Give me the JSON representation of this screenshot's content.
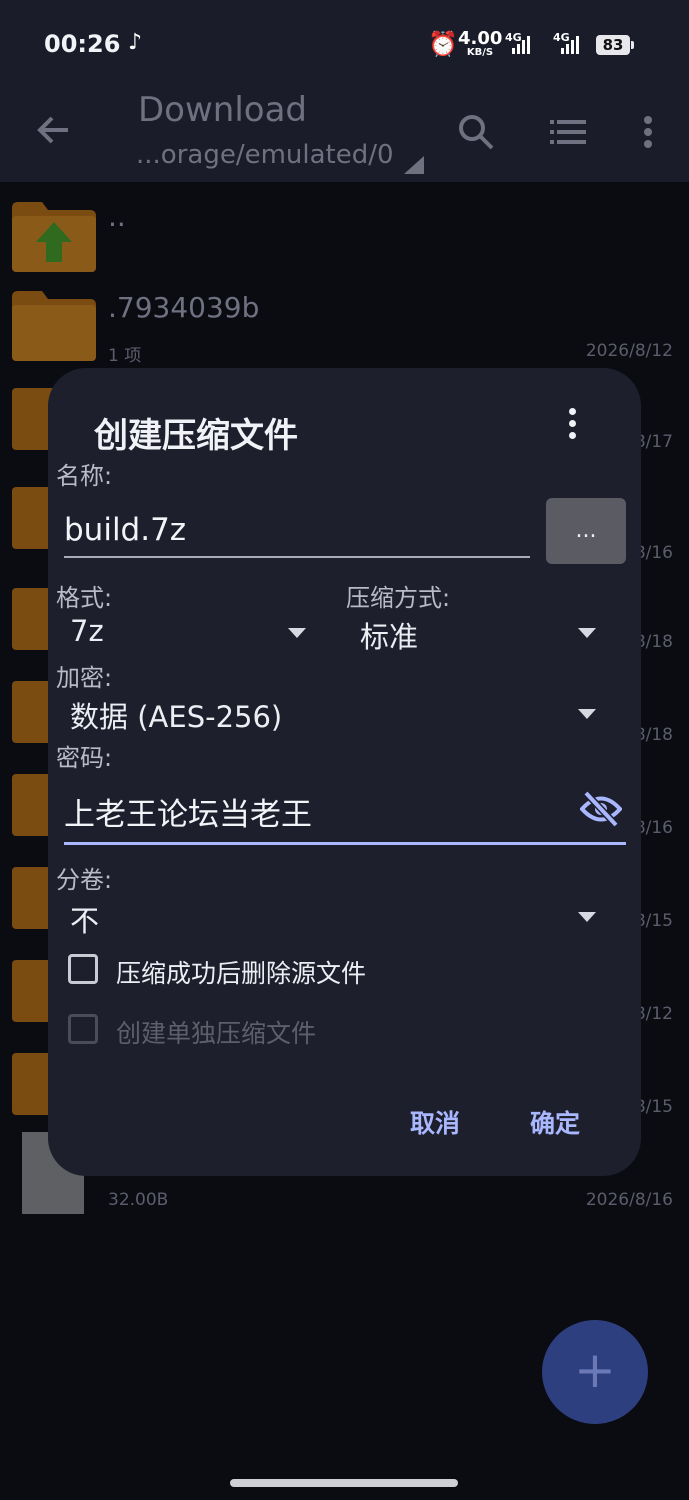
{
  "status_bar": {
    "time": "00:26",
    "net_speed_value": "4.00",
    "net_speed_unit": "KB/S",
    "signal1": "4G",
    "signal2": "4G",
    "battery": "83"
  },
  "appbar": {
    "title": "Download",
    "subtitle": "...orage/emulated/0"
  },
  "files": [
    {
      "name": "..",
      "count": "",
      "date": ""
    },
    {
      "name": ".7934039b",
      "count": "1 项",
      "date": "2026/8/12"
    },
    {
      "name": "",
      "count": "",
      "date": "8/17"
    },
    {
      "name": "",
      "count": "",
      "date": "8/16"
    },
    {
      "name": "",
      "count": "",
      "date": "8/18"
    },
    {
      "name": "",
      "count": "",
      "date": "8/18"
    },
    {
      "name": "",
      "count": "",
      "date": "8/16"
    },
    {
      "name": "",
      "count": "",
      "date": "8/15"
    },
    {
      "name": "",
      "count": "",
      "date": "8/12"
    },
    {
      "name": "",
      "count": "",
      "date": "8/15"
    },
    {
      "name": "",
      "count": "32.00B",
      "date": "2026/8/16"
    }
  ],
  "dialog": {
    "title": "创建压缩文件",
    "name_label": "名称:",
    "name_value": "build.7z",
    "browse_label": "...",
    "format_label": "格式:",
    "format_value": "7z",
    "method_label": "压缩方式:",
    "method_value": "标准",
    "encrypt_label": "加密:",
    "encrypt_value": "数据 (AES-256)",
    "password_label": "密码:",
    "password_value": "上老王论坛当老王",
    "split_label": "分卷:",
    "split_value": "不",
    "delete_source_label": "压缩成功后删除源文件",
    "separate_label": "创建单独压缩文件",
    "cancel_label": "取消",
    "ok_label": "确定"
  },
  "colors": {
    "accent": "#a9b7ff",
    "folder": "#e08a1e",
    "dialog_bg": "#1d1f2c"
  },
  "icons": [
    "back-arrow-icon",
    "search-icon",
    "list-view-icon",
    "more-vert-icon",
    "eye-off-icon",
    "plus-icon",
    "folder-icon",
    "folder-up-icon"
  ]
}
